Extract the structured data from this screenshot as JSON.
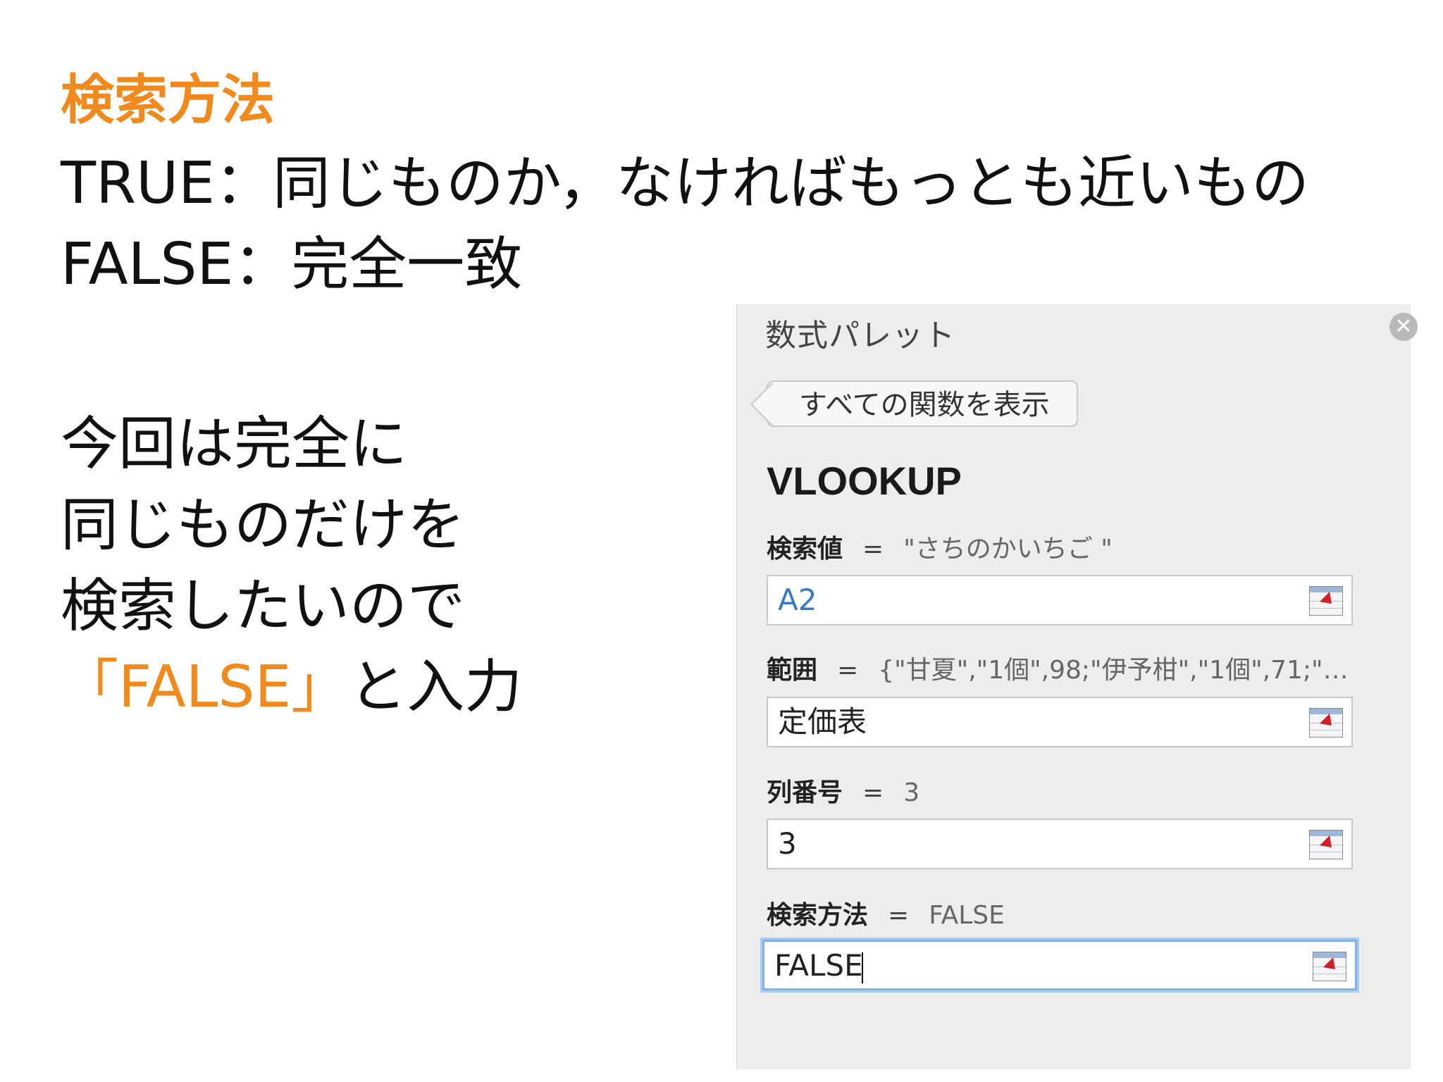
{
  "slide": {
    "heading": "検索方法",
    "true_line": "TRUE：同じものか，なければもっとも近いもの",
    "false_line": "FALSE：完全一致",
    "body_lines": [
      "今回は完全に",
      "同じものだけを",
      "検索したいので"
    ],
    "last_line_accent": "「FALSE」",
    "last_line_rest": "と入力",
    "accent_color": "#f08a1c"
  },
  "palette": {
    "title": "数式パレット",
    "close_icon": "close-circle-icon",
    "back_button": "すべての関数を表示",
    "function_name": "VLOOKUP",
    "args": [
      {
        "name": "検索値",
        "eq": "=",
        "value": "\"さちのかいちご \"",
        "input": "A2"
      },
      {
        "name": "範囲",
        "eq": "=",
        "value": "{\"甘夏\",\"1個\",98;\"伊予柑\",\"1個\",71;\"…",
        "input": "定価表"
      },
      {
        "name": "列番号",
        "eq": "=",
        "value": "3",
        "input": "3"
      },
      {
        "name": "検索方法",
        "eq": "=",
        "value": "FALSE",
        "input": "FALSE"
      }
    ]
  }
}
